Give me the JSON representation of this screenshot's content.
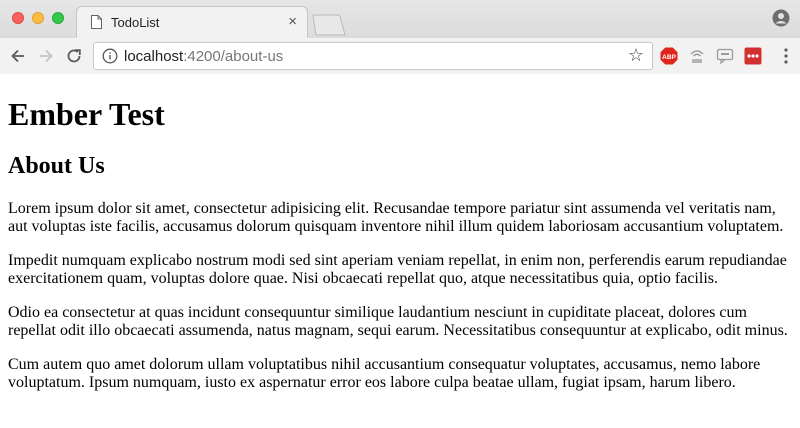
{
  "browser": {
    "tab": {
      "title": "TodoList",
      "close": "×"
    },
    "address": {
      "host": "localhost",
      "rest": ":4200/about-us"
    },
    "extensions": {
      "adblock": "ABP"
    }
  },
  "page": {
    "title": "Ember Test",
    "subtitle": "About Us",
    "paragraphs": [
      "Lorem ipsum dolor sit amet, consectetur adipisicing elit. Recusandae tempore pariatur sint assumenda vel veritatis nam, aut voluptas iste facilis, accusamus dolorum quisquam inventore nihil illum quidem laboriosam accusantium voluptatem.",
      "Impedit numquam explicabo nostrum modi sed sint aperiam veniam repellat, in enim non, perferendis earum repudiandae exercitationem quam, voluptas dolore quae. Nisi obcaecati repellat quo, atque necessitatibus quia, optio facilis.",
      "Odio ea consectetur at quas incidunt consequuntur similique laudantium nesciunt in cupiditate placeat, dolores cum repellat odit illo obcaecati assumenda, natus magnam, sequi earum. Necessitatibus consequuntur at explicabo, odit minus.",
      "Cum autem quo amet dolorum ullam voluptatibus nihil accusantium consequatur voluptates, accusamus, nemo labore voluptatum. Ipsum numquam, iusto ex aspernatur error eos labore culpa beatae ullam, fugiat ipsam, harum libero."
    ]
  }
}
